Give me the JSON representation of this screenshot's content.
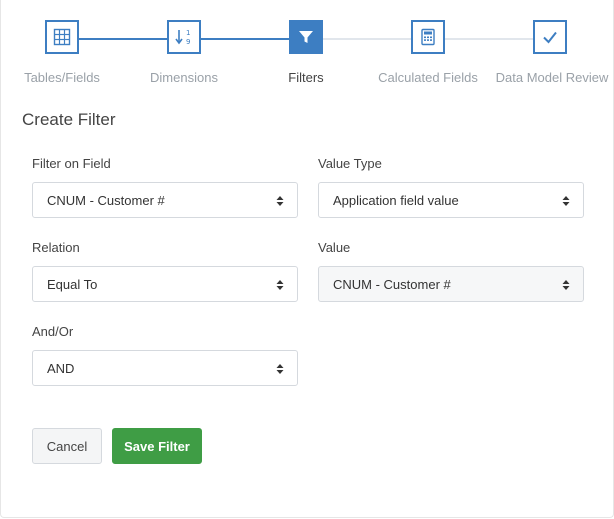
{
  "wizard": {
    "steps": [
      {
        "label": "Tables/Fields",
        "icon": "table-grid-icon"
      },
      {
        "label": "Dimensions",
        "icon": "sort-numeric-icon"
      },
      {
        "label": "Filters",
        "icon": "filter-icon"
      },
      {
        "label": "Calculated Fields",
        "icon": "calculator-icon"
      },
      {
        "label": "Data Model Review",
        "icon": "checkmark-icon"
      }
    ],
    "active_step": "Filters",
    "accent_color": "#3d7ec2"
  },
  "form": {
    "title": "Create Filter",
    "filter_on_field": {
      "label": "Filter on Field",
      "value": "CNUM - Customer #"
    },
    "value_type": {
      "label": "Value Type",
      "value": "Application field value"
    },
    "relation": {
      "label": "Relation",
      "value": "Equal To"
    },
    "value": {
      "label": "Value",
      "value": "CNUM - Customer #"
    },
    "and_or": {
      "label": "And/Or",
      "value": "AND"
    }
  },
  "actions": {
    "cancel_label": "Cancel",
    "save_label": "Save Filter",
    "save_color": "#3f9d45"
  }
}
